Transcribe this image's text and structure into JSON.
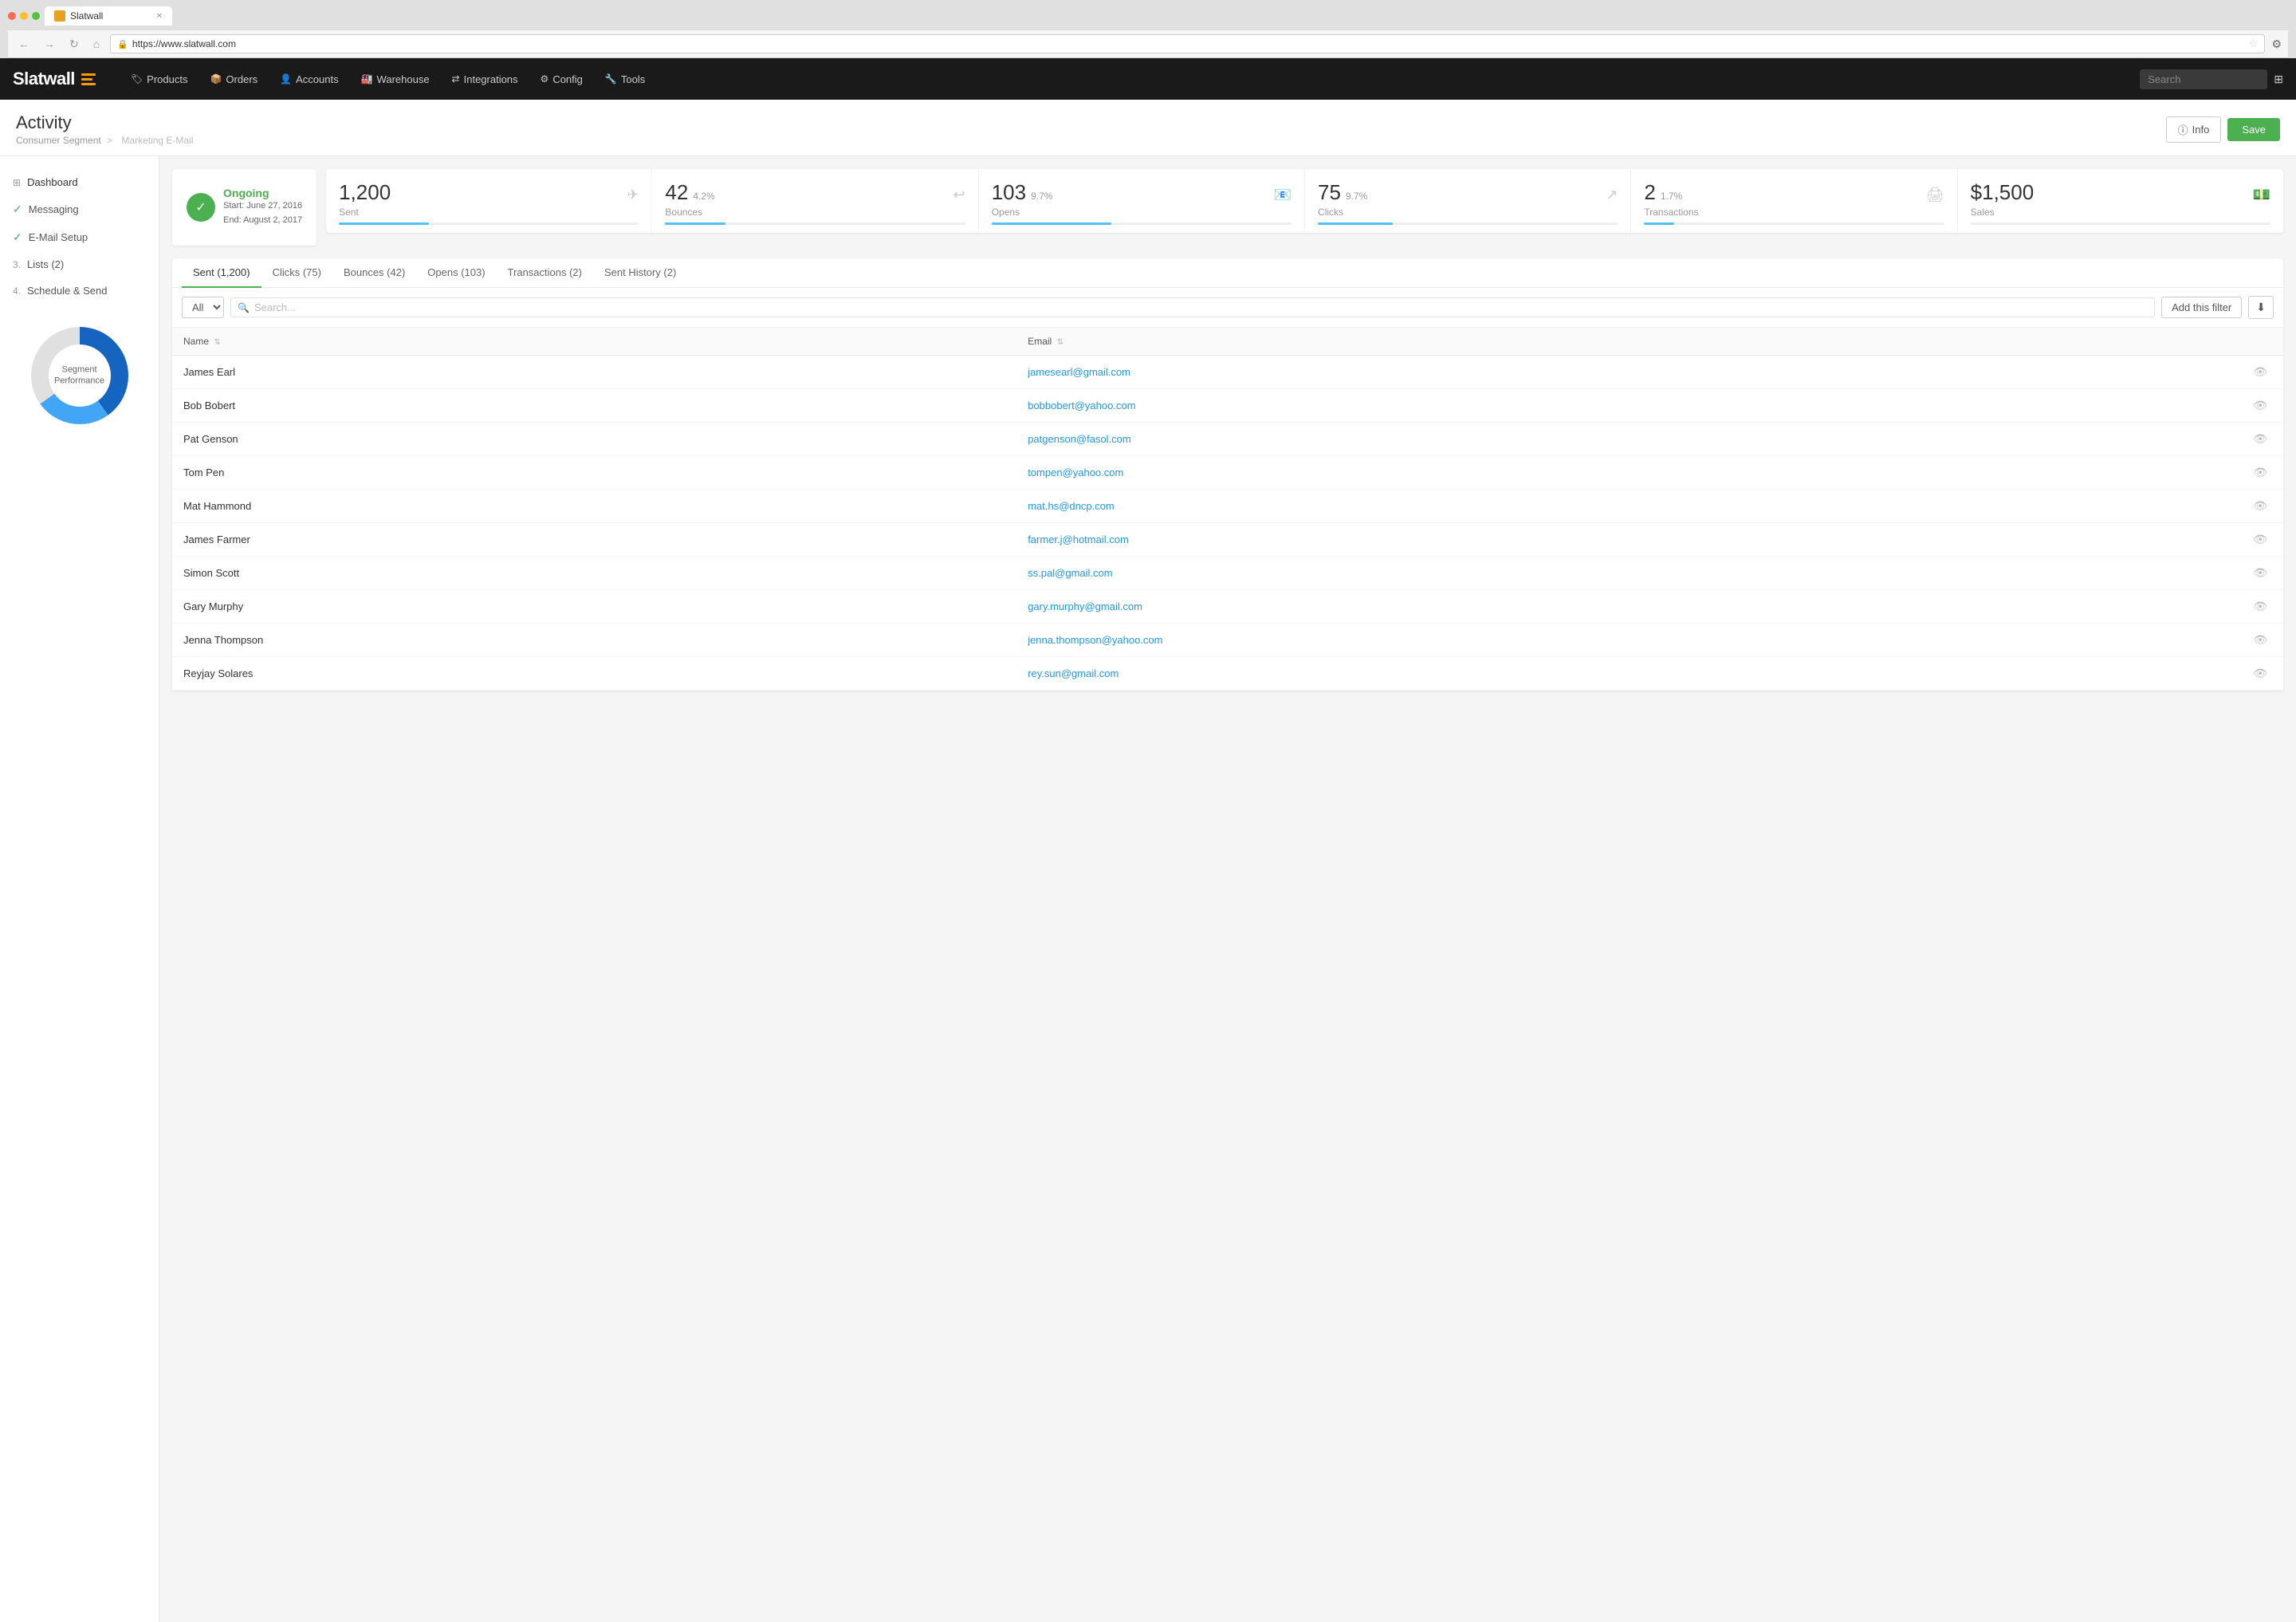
{
  "browser": {
    "tab_title": "Slatwall",
    "url": "https://www.slatwall.com",
    "search_placeholder": "Search"
  },
  "nav": {
    "logo_text": "Slatwall",
    "items": [
      {
        "label": "Products",
        "icon": "🏷"
      },
      {
        "label": "Orders",
        "icon": "📦"
      },
      {
        "label": "Accounts",
        "icon": "👤"
      },
      {
        "label": "Warehouse",
        "icon": "🏭"
      },
      {
        "label": "Integrations",
        "icon": "⇄"
      },
      {
        "label": "Config",
        "icon": "⚙"
      },
      {
        "label": "Tools",
        "icon": "🔧"
      }
    ],
    "search_placeholder": "Search"
  },
  "page": {
    "title": "Activity",
    "breadcrumb_parent": "Consumer Segment",
    "breadcrumb_child": "Marketing E-Mail",
    "btn_info": "Info",
    "btn_save": "Save"
  },
  "status": {
    "label": "Ongoing",
    "start": "Start: June 27, 2016",
    "end": "End: August 2, 2017"
  },
  "metrics": [
    {
      "value": "1,200",
      "pct": "",
      "label": "Sent",
      "bar_pct": 30,
      "icon": "✈"
    },
    {
      "value": "42",
      "pct": "4.2%",
      "label": "Bounces",
      "bar_pct": 20,
      "icon": "↩"
    },
    {
      "value": "103",
      "pct": "9.7%",
      "label": "Opens",
      "bar_pct": 40,
      "icon": "📧"
    },
    {
      "value": "75",
      "pct": "9.7%",
      "label": "Clicks",
      "bar_pct": 25,
      "icon": "↗"
    },
    {
      "value": "2",
      "pct": "1.7%",
      "label": "Transactions",
      "bar_pct": 10,
      "icon": "🖨"
    },
    {
      "value": "$1,500",
      "pct": "",
      "label": "Sales",
      "bar_pct": 0,
      "icon": "💵"
    }
  ],
  "sidebar": {
    "items": [
      {
        "label": "Dashboard",
        "type": "icon",
        "step": ""
      },
      {
        "label": "Messaging",
        "type": "check",
        "step": ""
      },
      {
        "label": "E-Mail Setup",
        "type": "check",
        "step": ""
      },
      {
        "label": "Lists (2)",
        "type": "num",
        "step": "3."
      },
      {
        "label": "Schedule & Send",
        "type": "num",
        "step": "4."
      }
    ],
    "chart_label": "Segment\nPerformance"
  },
  "tabs": [
    {
      "label": "Sent (1,200)",
      "active": true
    },
    {
      "label": "Clicks (75)",
      "active": false
    },
    {
      "label": "Bounces (42)",
      "active": false
    },
    {
      "label": "Opens (103)",
      "active": false
    },
    {
      "label": "Transactions (2)",
      "active": false
    },
    {
      "label": "Sent History (2)",
      "active": false
    }
  ],
  "table": {
    "filter_option": "All",
    "search_placeholder": "Search...",
    "add_filter_btn": "Add this filter",
    "columns": [
      {
        "label": "Name",
        "sort": true
      },
      {
        "label": "Email",
        "sort": true
      },
      {
        "label": "",
        "sort": false
      }
    ],
    "rows": [
      {
        "name": "James Earl",
        "email": "jamesearl@gmail.com"
      },
      {
        "name": "Bob Bobert",
        "email": "bobbobert@yahoo.com"
      },
      {
        "name": "Pat Genson",
        "email": "patgenson@fasol.com"
      },
      {
        "name": "Tom Pen",
        "email": "tompen@yahoo.com"
      },
      {
        "name": "Mat Hammond",
        "email": "mat.hs@dncp.com"
      },
      {
        "name": "James Farmer",
        "email": "farmer.j@hotmail.com"
      },
      {
        "name": "Simon Scott",
        "email": "ss.pal@gmail.com"
      },
      {
        "name": "Gary Murphy",
        "email": "gary.murphy@gmail.com"
      },
      {
        "name": "Jenna Thompson",
        "email": "jenna.thompson@yahoo.com"
      },
      {
        "name": "Reyjay Solares",
        "email": "rey.sun@gmail.com"
      }
    ]
  },
  "chart": {
    "segments": [
      {
        "color": "#1565c0",
        "pct": 40
      },
      {
        "color": "#42a5f5",
        "pct": 25
      },
      {
        "color": "#e0e0e0",
        "pct": 35
      }
    ]
  }
}
